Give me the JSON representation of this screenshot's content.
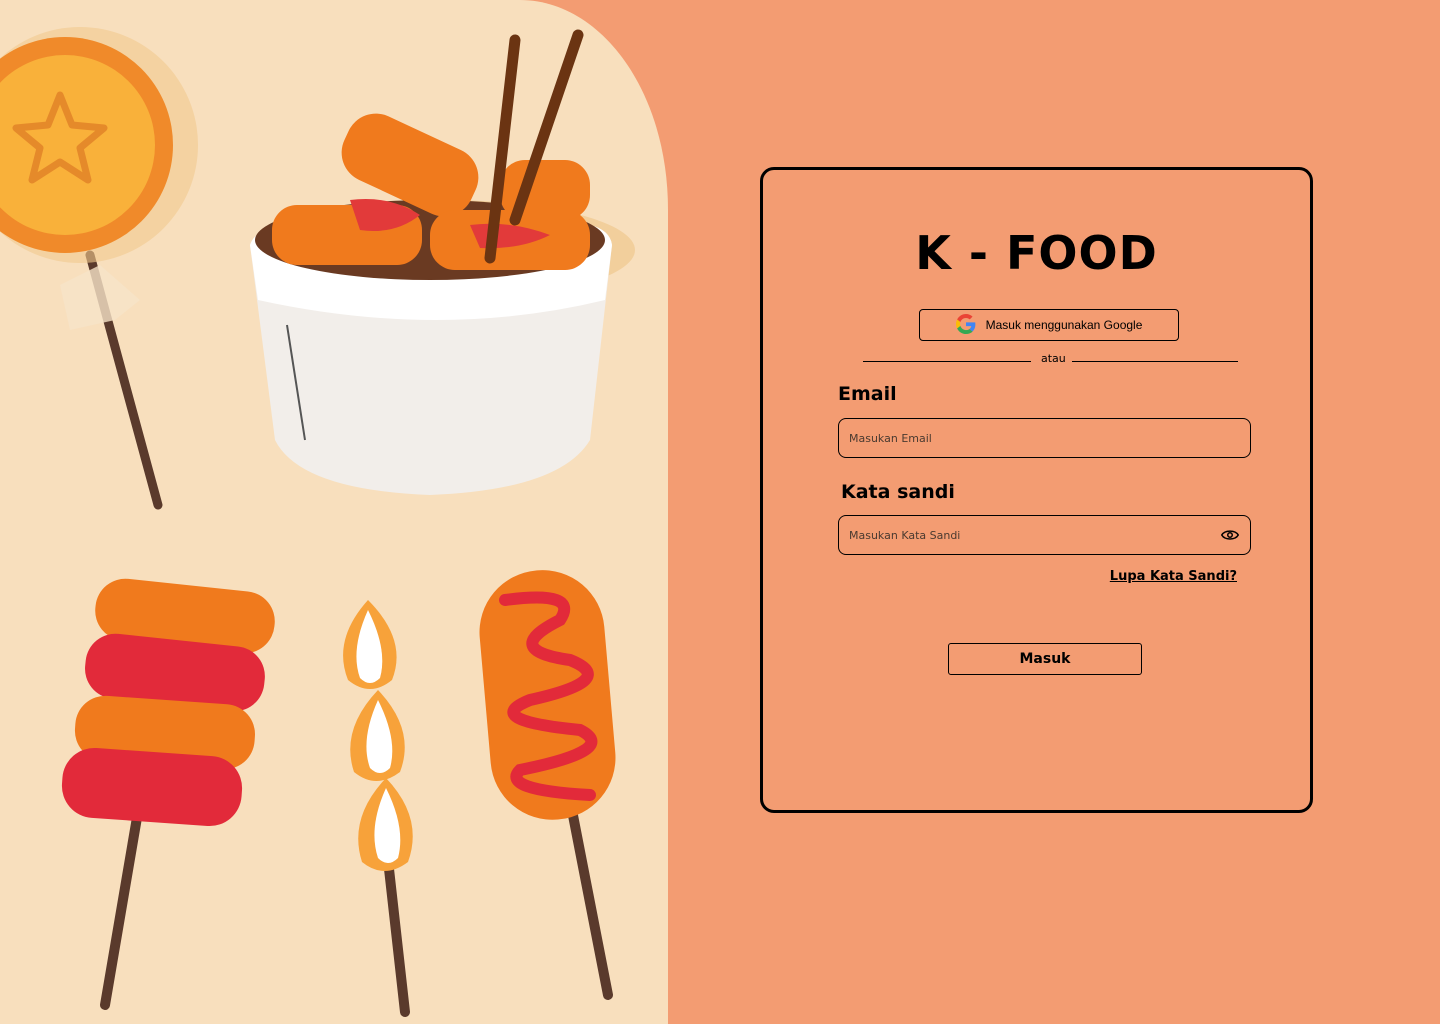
{
  "brand": {
    "title": "K - FOOD"
  },
  "login": {
    "google_label": "Masuk menggunakan Google",
    "divider_text": "atau",
    "email_label": "Email",
    "email_placeholder": "Masukan Email",
    "password_label": "Kata sandi",
    "password_placeholder": "Masukan Kata Sandi",
    "forgot_label": "Lupa Kata Sandi?",
    "submit_label": "Masuk"
  },
  "icons": {
    "google": "google-logo-icon",
    "password_toggle": "eye-icon"
  },
  "colors": {
    "background": "#f39c72",
    "illustration_panel": "#f8dfbd",
    "border": "#000000"
  }
}
